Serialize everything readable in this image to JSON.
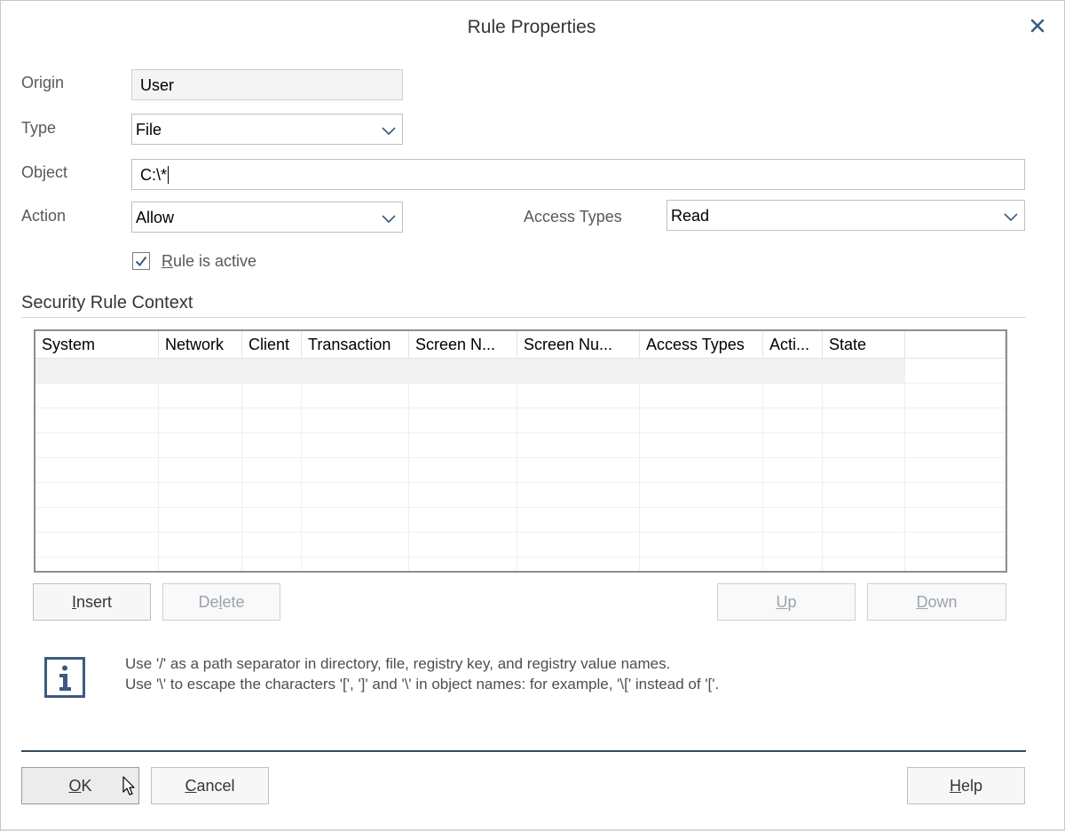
{
  "dialog": {
    "title": "Rule Properties",
    "close_icon": "close-icon"
  },
  "form": {
    "origin": {
      "label": "Origin",
      "value": "User"
    },
    "type": {
      "label": "Type",
      "value": "File"
    },
    "object": {
      "label": "Object",
      "value": "C:\\*"
    },
    "action": {
      "label": "Action",
      "value": "Allow"
    },
    "access_types": {
      "label": "Access Types",
      "value": "Read"
    },
    "rule_active": {
      "label_accel": "R",
      "label_rest": "ule is active",
      "checked": true
    }
  },
  "context": {
    "title": "Security Rule Context",
    "columns": [
      "System",
      "Network",
      "Client",
      "Transaction",
      "Screen N...",
      "Screen Nu...",
      "Access Types",
      "Acti...",
      "State"
    ]
  },
  "buttons": {
    "insert": {
      "pre": "",
      "accel": "I",
      "post": "nsert"
    },
    "delete": {
      "pre": "De",
      "accel": "l",
      "post": "ete"
    },
    "up": {
      "pre": "",
      "accel": "U",
      "post": "p"
    },
    "down": {
      "pre": "",
      "accel": "D",
      "post": "own"
    },
    "ok": {
      "pre": "",
      "accel": "O",
      "post": "K"
    },
    "cancel": {
      "pre": "",
      "accel": "C",
      "post": "ancel"
    },
    "help": {
      "pre": "",
      "accel": "H",
      "post": "elp"
    }
  },
  "info": {
    "icon": "info-icon",
    "line1": "Use '/' as a path separator in directory, file, registry key, and registry value names.",
    "line2": "Use '\\' to escape the characters '[', ']' and '\\' in object names: for example, '\\[' instead of '['."
  },
  "colors": {
    "accent": "#3b5a7f",
    "footer_rule": "#394a5c",
    "disabled_text": "#9aa4ad"
  }
}
